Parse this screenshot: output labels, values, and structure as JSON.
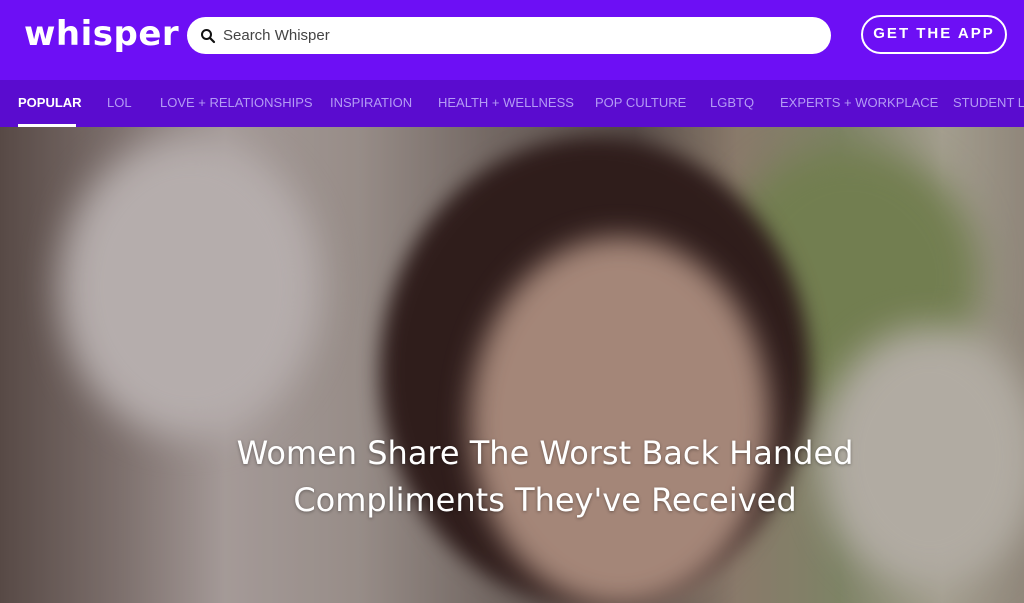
{
  "header": {
    "logo": "whisper",
    "search_placeholder": "Search Whisper",
    "get_app_label": "GET THE APP"
  },
  "nav": {
    "items": [
      {
        "label": "POPULAR",
        "active": true
      },
      {
        "label": "LOL"
      },
      {
        "label": "LOVE + RELATIONSHIPS"
      },
      {
        "label": "INSPIRATION"
      },
      {
        "label": "HEALTH + WELLNESS"
      },
      {
        "label": "POP CULTURE"
      },
      {
        "label": "LGBTQ"
      },
      {
        "label": "EXPERTS + WORKPLACE"
      },
      {
        "label": "STUDENT LI"
      }
    ]
  },
  "hero": {
    "title_line1": "Women Share The Worst Back Handed",
    "title_line2": "Compliments They've Received"
  },
  "colors": {
    "header_bg": "#6d0ff5",
    "nav_bg": "#5a0ccf",
    "nav_inactive": "#b49bf5"
  }
}
